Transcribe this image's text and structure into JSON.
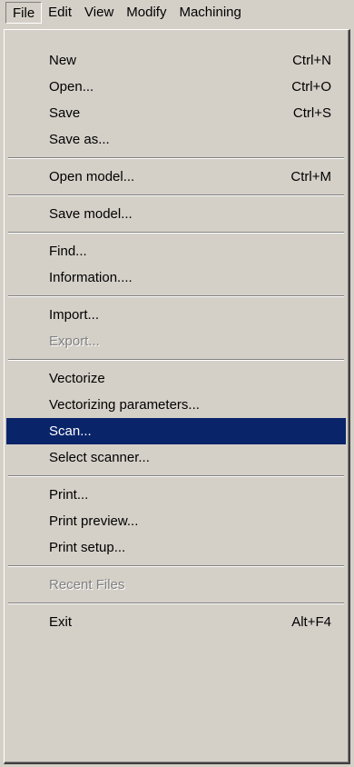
{
  "menubar": {
    "items": [
      {
        "label": "File"
      },
      {
        "label": "Edit"
      },
      {
        "label": "View"
      },
      {
        "label": "Modify"
      },
      {
        "label": "Machining"
      }
    ]
  },
  "file_menu": {
    "items": [
      {
        "label": "New",
        "shortcut": "Ctrl+N"
      },
      {
        "label": "Open...",
        "shortcut": "Ctrl+O"
      },
      {
        "label": "Save",
        "shortcut": "Ctrl+S"
      },
      {
        "label": "Save as..."
      },
      {
        "label": "Open model...",
        "shortcut": "Ctrl+M"
      },
      {
        "label": "Save model..."
      },
      {
        "label": "Find..."
      },
      {
        "label": "Information...."
      },
      {
        "label": "Import..."
      },
      {
        "label": "Export..."
      },
      {
        "label": "Vectorize"
      },
      {
        "label": "Vectorizing parameters..."
      },
      {
        "label": "Scan..."
      },
      {
        "label": "Select scanner..."
      },
      {
        "label": "Print..."
      },
      {
        "label": "Print preview..."
      },
      {
        "label": "Print setup..."
      },
      {
        "label": "Recent Files"
      },
      {
        "label": "Exit",
        "shortcut": "Alt+F4"
      }
    ]
  },
  "colors": {
    "menu_bg": "#d4d0c8",
    "highlight": "#0a246a",
    "disabled_text": "#808080"
  }
}
